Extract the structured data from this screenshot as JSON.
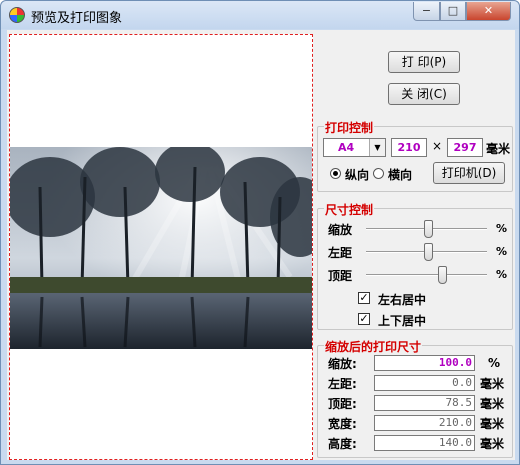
{
  "window": {
    "title": "预览及打印图象",
    "minimize": "−",
    "maximize": "□",
    "close": "✕"
  },
  "buttons": {
    "print": "打 印(P)",
    "close": "关 闭(C)"
  },
  "print_control": {
    "title": "打印控制",
    "paper": "A4",
    "width": "210",
    "times": "×",
    "height": "297",
    "unit": "毫米",
    "portrait": "纵向",
    "landscape": "横向",
    "orientation_selected": "portrait",
    "printer_button": "打印机(D)"
  },
  "size_control": {
    "title": "尺寸控制",
    "sliders": [
      {
        "label": "缩放",
        "unit": "%",
        "level": 0.52
      },
      {
        "label": "左距",
        "unit": "%",
        "level": 0.52
      },
      {
        "label": "顶距",
        "unit": "%",
        "level": 0.63
      }
    ],
    "checkboxes": [
      {
        "label": "左右居中",
        "checked": true
      },
      {
        "label": "上下居中",
        "checked": true
      }
    ]
  },
  "print_size": {
    "title": "缩放后的打印尺寸",
    "rows": [
      {
        "label": "缩放:",
        "value": "100.0",
        "unit": "%"
      },
      {
        "label": "左距:",
        "value": "0.0",
        "unit": "毫米"
      },
      {
        "label": "顶距:",
        "value": "78.5",
        "unit": "毫米"
      },
      {
        "label": "宽度:",
        "value": "210.0",
        "unit": "毫米"
      },
      {
        "label": "高度:",
        "value": "140.0",
        "unit": "毫米"
      }
    ]
  },
  "colors": {
    "accent_red": "#d40000",
    "value_magenta": "#b000c0",
    "preview_border": "#e02020"
  },
  "icons": [
    "app-icon",
    "minimize-icon",
    "maximize-icon",
    "close-icon",
    "dropdown-arrow-icon",
    "checkmark-icon"
  ]
}
